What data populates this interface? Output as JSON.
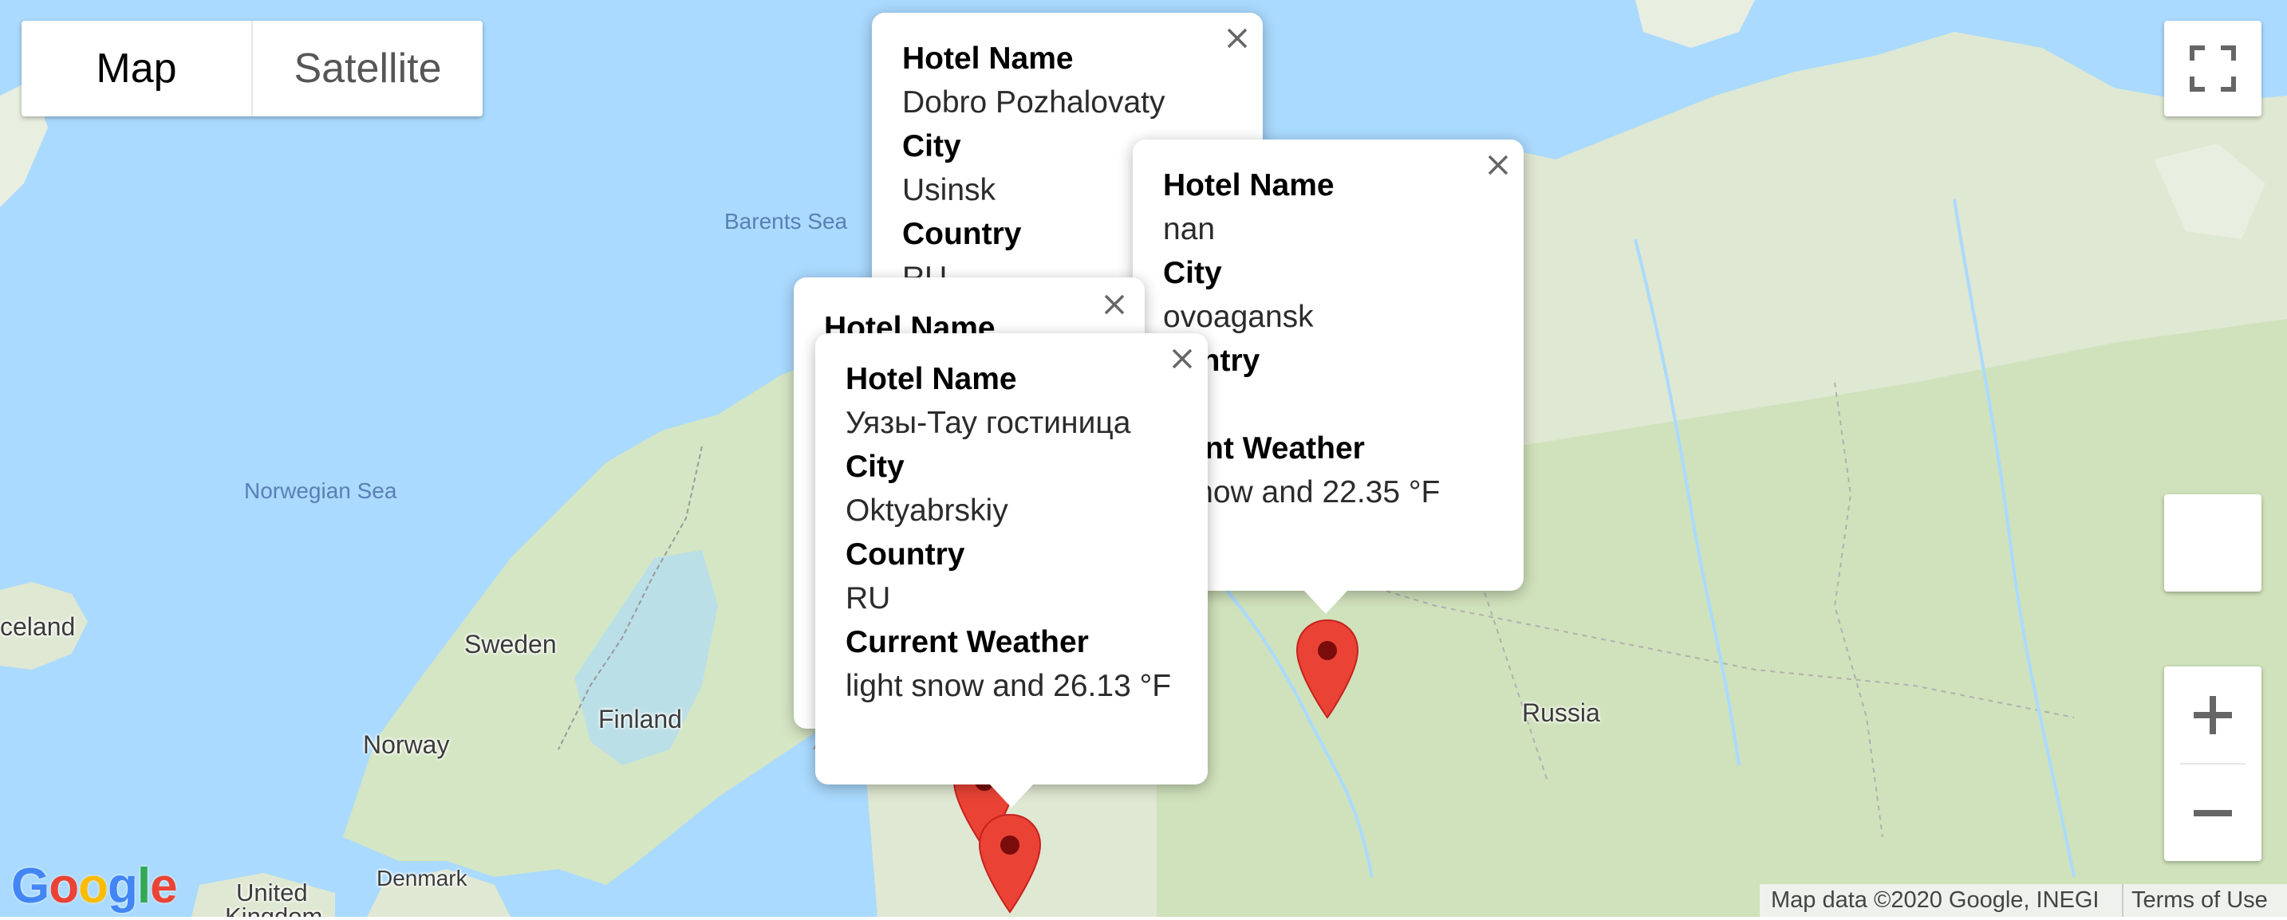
{
  "map_type": {
    "map": "Map",
    "satellite": "Satellite"
  },
  "labels": {
    "barents_sea": "Barents Sea",
    "norwegian_sea": "Norwegian Sea",
    "iceland": "celand",
    "sweden": "Sweden",
    "finland": "Finland",
    "norway": "Norway",
    "russia": "Russia",
    "denmark": "Denmark",
    "united_kingdom_1": "United",
    "united_kingdom_2": "Kingdom"
  },
  "infowindows": {
    "usinsk": {
      "hotel_key": "Hotel Name",
      "hotel": "Dobro Pozhalovaty",
      "city_key": "City",
      "city": "Usinsk",
      "country_key": "Country",
      "country": "RU"
    },
    "novoagansk": {
      "hotel_key": "Hotel Name",
      "hotel": "nan",
      "city_key": "City",
      "city": "ovoagansk",
      "country_key": "ountry",
      "weather_key": "rrent Weather",
      "weather": "t snow and 22.35 °F"
    },
    "hidden": {
      "hotel_key": "Hotel Name"
    },
    "oktyabrskiy": {
      "hotel_key": "Hotel Name",
      "hotel": "Уязы-Тау гостиница",
      "city_key": "City",
      "city": "Oktyabrskiy",
      "country_key": "Country",
      "country": "RU",
      "weather_key": "Current Weather",
      "weather": "light snow and 26.13 °F"
    }
  },
  "attribution": {
    "map_data": "Map data ©2020 Google, INEGI",
    "terms": "Terms of Use"
  },
  "logo": "Google",
  "colors": {
    "water": "#aadaff",
    "land": "#dfe8d2",
    "forest": "#c9dfb0",
    "marker": "#ea4335",
    "marker_dot": "#7a0c0c"
  }
}
